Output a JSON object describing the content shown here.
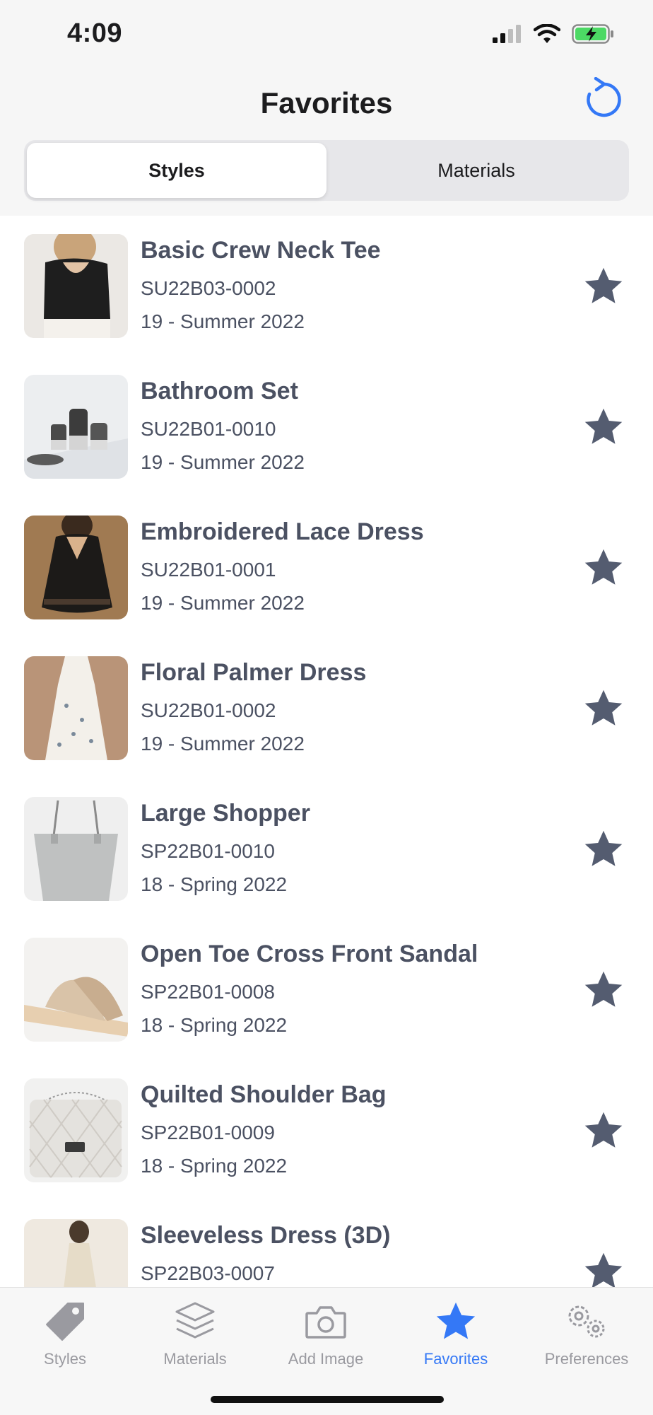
{
  "status": {
    "time": "4:09"
  },
  "header": {
    "title": "Favorites"
  },
  "segments": {
    "styles": "Styles",
    "materials": "Materials",
    "selected": "Styles"
  },
  "colors": {
    "accent": "#3478f6",
    "star": "#545c70",
    "text": "#4b5162"
  },
  "items": [
    {
      "title": "Basic Crew Neck Tee",
      "code": "SU22B03-0002",
      "season": "19 - Summer 2022",
      "favorite": true
    },
    {
      "title": "Bathroom Set",
      "code": "SU22B01-0010",
      "season": "19 - Summer 2022",
      "favorite": true
    },
    {
      "title": "Embroidered Lace Dress",
      "code": "SU22B01-0001",
      "season": "19 - Summer 2022",
      "favorite": true
    },
    {
      "title": "Floral Palmer Dress",
      "code": "SU22B01-0002",
      "season": "19 - Summer 2022",
      "favorite": true
    },
    {
      "title": "Large Shopper",
      "code": "SP22B01-0010",
      "season": "18 - Spring 2022",
      "favorite": true
    },
    {
      "title": "Open Toe Cross Front Sandal",
      "code": "SP22B01-0008",
      "season": "18 - Spring 2022",
      "favorite": true
    },
    {
      "title": "Quilted Shoulder Bag",
      "code": "SP22B01-0009",
      "season": "18 - Spring 2022",
      "favorite": true
    },
    {
      "title": "Sleeveless Dress (3D)",
      "code": "SP22B03-0007",
      "season": "",
      "favorite": true
    }
  ],
  "tabs": [
    {
      "label": "Styles",
      "icon": "tag-icon",
      "active": false
    },
    {
      "label": "Materials",
      "icon": "layers-icon",
      "active": false
    },
    {
      "label": "Add Image",
      "icon": "camera-icon",
      "active": false
    },
    {
      "label": "Favorites",
      "icon": "star-icon",
      "active": true
    },
    {
      "label": "Preferences",
      "icon": "gears-icon",
      "active": false
    }
  ]
}
